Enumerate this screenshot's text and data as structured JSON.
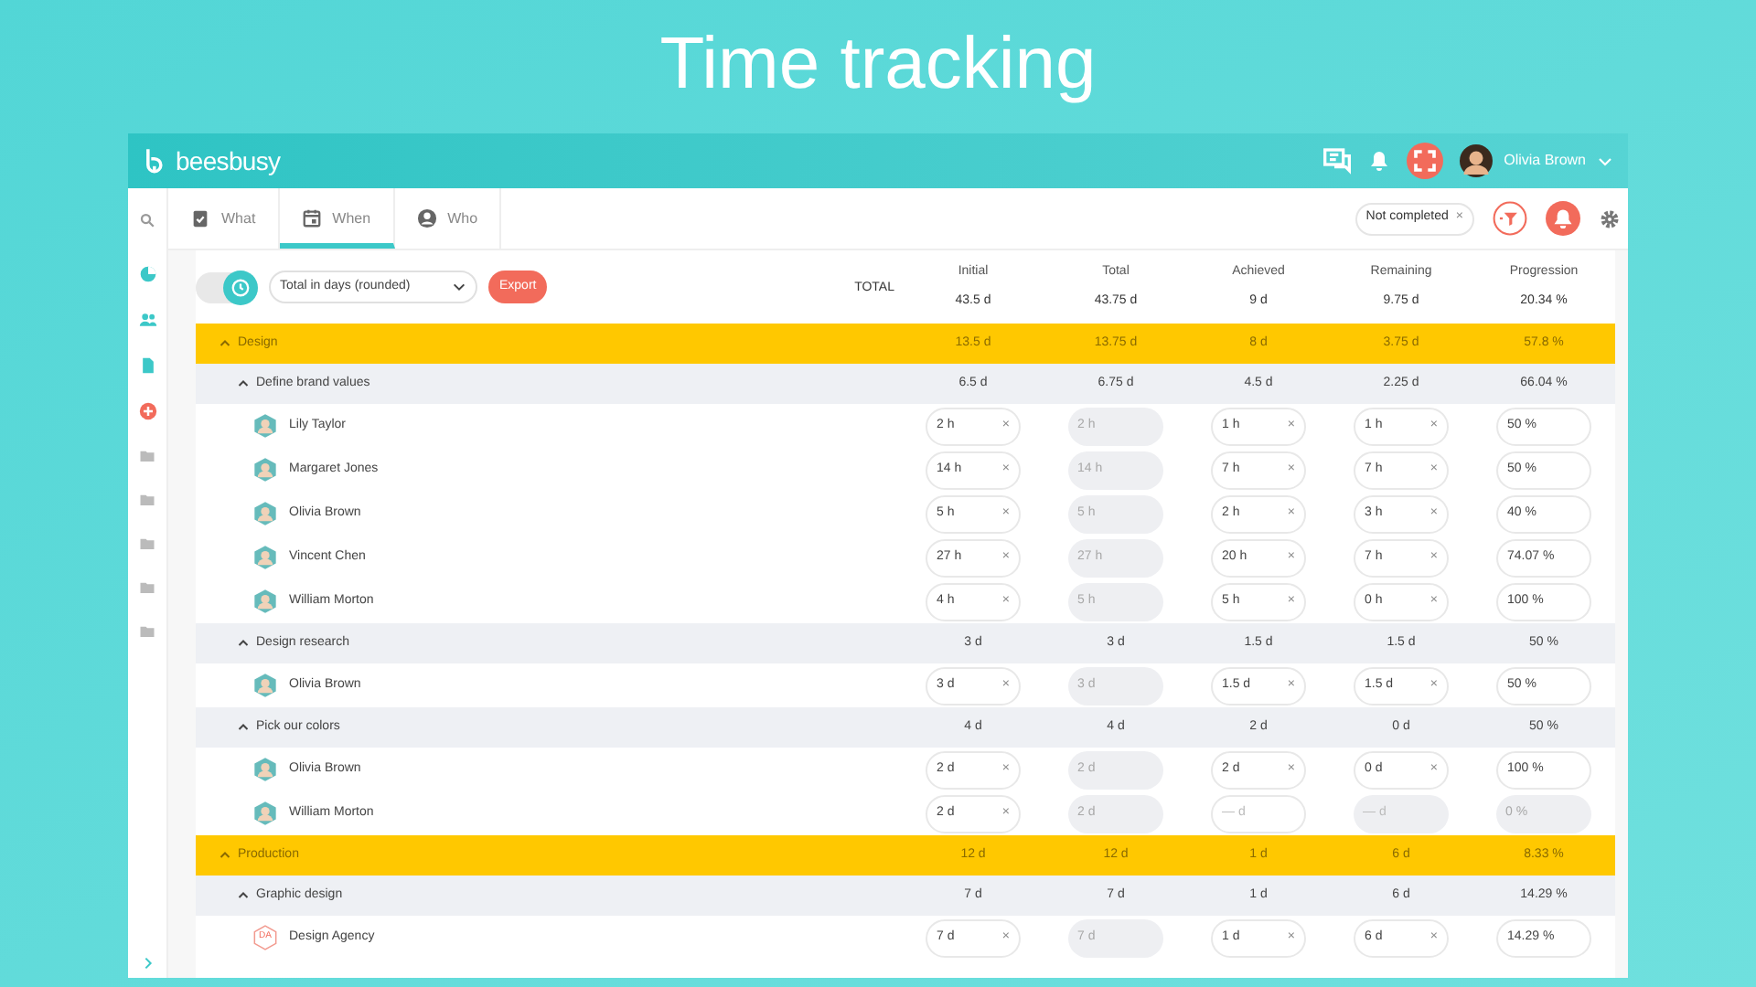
{
  "slide_title": "Time tracking",
  "header": {
    "logo": "beesbusy",
    "user_name": "Olivia Brown"
  },
  "tabs": [
    {
      "label": "What",
      "selected": false
    },
    {
      "label": "When",
      "selected": true
    },
    {
      "label": "Who",
      "selected": false
    }
  ],
  "filter_chip": {
    "label": "Not completed",
    "remove": "×"
  },
  "toolbar": {
    "toggle_on": true,
    "display_select": "Total in days (rounded)",
    "export_button": "Export"
  },
  "columns": [
    "Initial",
    "Total",
    "Achieved",
    "Remaining",
    "Progression"
  ],
  "total_row": {
    "label": "TOTAL",
    "values": [
      "43.5 d",
      "43.75 d",
      "9 d",
      "9.75 d",
      "20.34 %"
    ]
  },
  "groups": [
    {
      "name": "Design",
      "expanded": true,
      "values": [
        "13.5 d",
        "13.75 d",
        "8 d",
        "3.75 d",
        "57.8 %"
      ],
      "tasks": [
        {
          "name": "Define brand values",
          "expanded": true,
          "values": [
            "6.5 d",
            "6.75 d",
            "4.5 d",
            "2.25 d",
            "66.04 %"
          ],
          "members": [
            {
              "name": "Lily Taylor",
              "fields": [
                {
                  "value": "2 h",
                  "clear": "×"
                },
                {
                  "value": "2 h",
                  "disabled": true
                },
                {
                  "value": "1 h",
                  "clear": "×"
                },
                {
                  "value": "1 h",
                  "clear": "×"
                },
                {
                  "value": "50 %"
                }
              ]
            },
            {
              "name": "Margaret Jones",
              "fields": [
                {
                  "value": "14 h",
                  "clear": "×"
                },
                {
                  "value": "14 h",
                  "disabled": true
                },
                {
                  "value": "7 h",
                  "clear": "×"
                },
                {
                  "value": "7 h",
                  "clear": "×"
                },
                {
                  "value": "50 %"
                }
              ]
            },
            {
              "name": "Olivia Brown",
              "fields": [
                {
                  "value": "5 h",
                  "clear": "×"
                },
                {
                  "value": "5 h",
                  "disabled": true
                },
                {
                  "value": "2 h",
                  "clear": "×"
                },
                {
                  "value": "3 h",
                  "clear": "×"
                },
                {
                  "value": "40 %"
                }
              ]
            },
            {
              "name": "Vincent Chen",
              "fields": [
                {
                  "value": "27 h",
                  "clear": "×"
                },
                {
                  "value": "27 h",
                  "disabled": true
                },
                {
                  "value": "20 h",
                  "clear": "×"
                },
                {
                  "value": "7 h",
                  "clear": "×"
                },
                {
                  "value": "74.07 %"
                }
              ]
            },
            {
              "name": "William Morton",
              "fields": [
                {
                  "value": "4 h",
                  "clear": "×"
                },
                {
                  "value": "5 h",
                  "disabled": true
                },
                {
                  "value": "5 h",
                  "clear": "×"
                },
                {
                  "value": "0 h",
                  "clear": "×"
                },
                {
                  "value": "100 %"
                }
              ]
            }
          ]
        },
        {
          "name": "Design research",
          "expanded": true,
          "values": [
            "3 d",
            "3 d",
            "1.5 d",
            "1.5 d",
            "50 %"
          ],
          "members": [
            {
              "name": "Olivia Brown",
              "fields": [
                {
                  "value": "3 d",
                  "clear": "×"
                },
                {
                  "value": "3 d",
                  "disabled": true
                },
                {
                  "value": "1.5 d",
                  "clear": "×"
                },
                {
                  "value": "1.5 d",
                  "clear": "×"
                },
                {
                  "value": "50 %"
                }
              ]
            }
          ]
        },
        {
          "name": "Pick our colors",
          "expanded": true,
          "values": [
            "4 d",
            "4 d",
            "2 d",
            "0 d",
            "50 %"
          ],
          "members": [
            {
              "name": "Olivia Brown",
              "fields": [
                {
                  "value": "2 d",
                  "clear": "×"
                },
                {
                  "value": "2 d",
                  "disabled": true
                },
                {
                  "value": "2 d",
                  "clear": "×"
                },
                {
                  "value": "0 d",
                  "clear": "×"
                },
                {
                  "value": "100 %"
                }
              ]
            },
            {
              "name": "William Morton",
              "fields": [
                {
                  "value": "2 d",
                  "clear": "×"
                },
                {
                  "value": "2 d",
                  "disabled": true
                },
                {
                  "placeholder": "— d"
                },
                {
                  "placeholder": "— d",
                  "disabled": true
                },
                {
                  "value": "0 %",
                  "disabled": true
                }
              ]
            }
          ]
        }
      ]
    },
    {
      "name": "Production",
      "expanded": true,
      "values": [
        "12 d",
        "12 d",
        "1 d",
        "6 d",
        "8.33 %"
      ],
      "tasks": [
        {
          "name": "Graphic design",
          "expanded": true,
          "values": [
            "7 d",
            "7 d",
            "1 d",
            "6 d",
            "14.29 %"
          ],
          "members": [
            {
              "name": "Design Agency",
              "initials": "DA",
              "fields": [
                {
                  "value": "7 d",
                  "clear": "×"
                },
                {
                  "value": "7 d",
                  "disabled": true
                },
                {
                  "value": "1 d",
                  "clear": "×"
                },
                {
                  "value": "6 d",
                  "clear": "×"
                },
                {
                  "value": "14.29 %"
                }
              ]
            }
          ]
        }
      ]
    }
  ]
}
